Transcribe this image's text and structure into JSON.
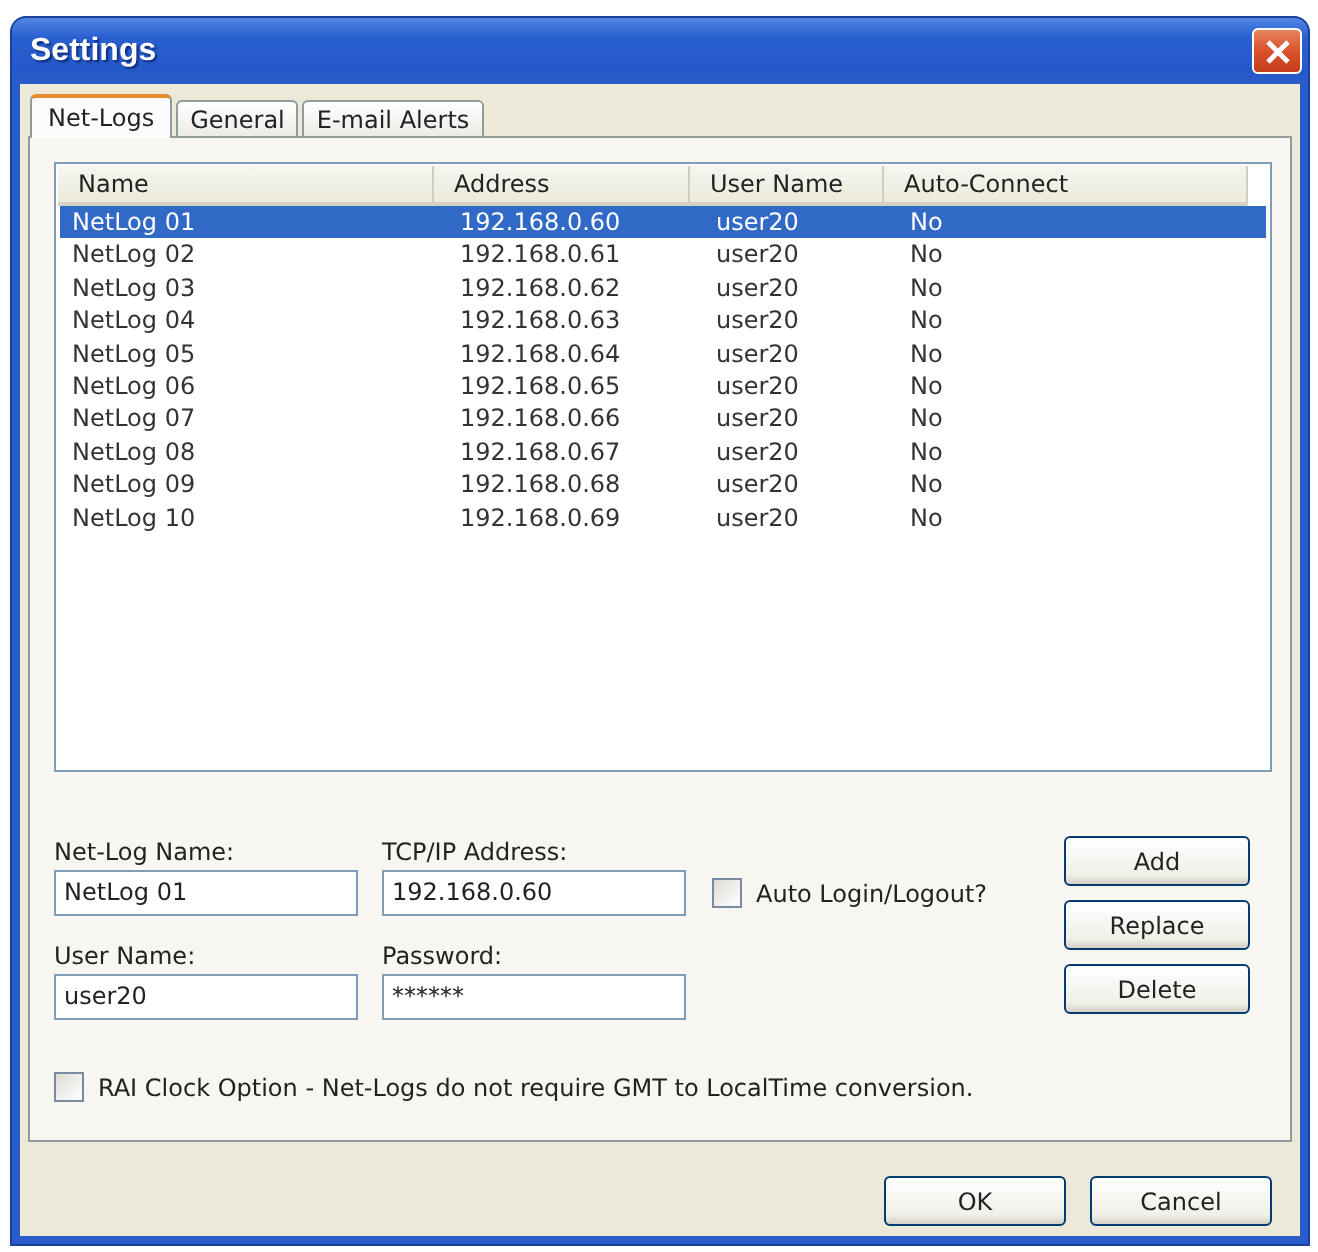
{
  "window": {
    "title": "Settings"
  },
  "tabs": [
    {
      "label": "Net-Logs",
      "selected": true
    },
    {
      "label": "General",
      "selected": false
    },
    {
      "label": "E-mail Alerts",
      "selected": false
    }
  ],
  "table": {
    "columns": [
      "Name",
      "Address",
      "User Name",
      "Auto-Connect"
    ],
    "rows": [
      {
        "cells": [
          "NetLog 01",
          "192.168.0.60",
          "user20",
          "No"
        ],
        "selected": true
      },
      {
        "cells": [
          "NetLog 02",
          "192.168.0.61",
          "user20",
          "No"
        ],
        "selected": false
      },
      {
        "cells": [
          "NetLog 03",
          "192.168.0.62",
          "user20",
          "No"
        ],
        "selected": false
      },
      {
        "cells": [
          "NetLog 04",
          "192.168.0.63",
          "user20",
          "No"
        ],
        "selected": false
      },
      {
        "cells": [
          "NetLog 05",
          "192.168.0.64",
          "user20",
          "No"
        ],
        "selected": false
      },
      {
        "cells": [
          "NetLog 06",
          "192.168.0.65",
          "user20",
          "No"
        ],
        "selected": false
      },
      {
        "cells": [
          "NetLog 07",
          "192.168.0.66",
          "user20",
          "No"
        ],
        "selected": false
      },
      {
        "cells": [
          "NetLog 08",
          "192.168.0.67",
          "user20",
          "No"
        ],
        "selected": false
      },
      {
        "cells": [
          "NetLog 09",
          "192.168.0.68",
          "user20",
          "No"
        ],
        "selected": false
      },
      {
        "cells": [
          "NetLog 10",
          "192.168.0.69",
          "user20",
          "No"
        ],
        "selected": false
      }
    ]
  },
  "form": {
    "fields": [
      {
        "label": "Net-Log Name:",
        "value": "NetLog 01"
      },
      {
        "label": "TCP/IP Address:",
        "value": "192.168.0.60"
      },
      {
        "label": "User Name:",
        "value": "user20"
      },
      {
        "label": "Password:",
        "value": "******"
      }
    ],
    "auto_login": {
      "label": "Auto Login/Logout?",
      "checked": false
    },
    "buttons": [
      "Add",
      "Replace",
      "Delete"
    ]
  },
  "rai_clock": {
    "label": "RAI Clock Option - Net-Logs do not require GMT to LocalTime conversion.",
    "checked": false
  },
  "buttons": [
    "OK",
    "Cancel"
  ]
}
